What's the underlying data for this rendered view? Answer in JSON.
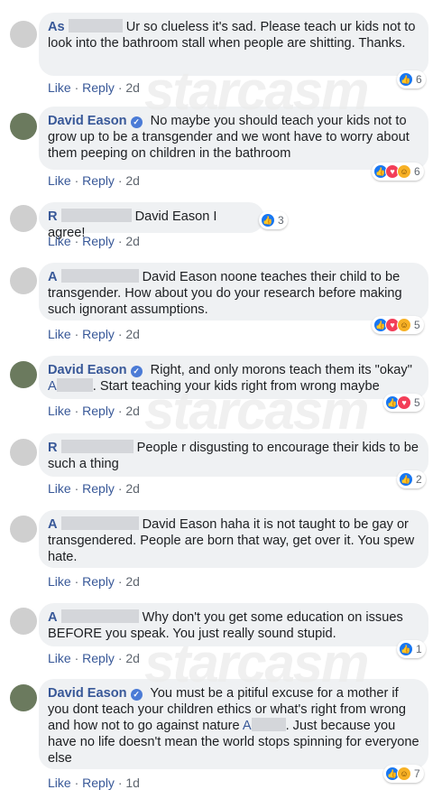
{
  "actions": {
    "like": "Like",
    "reply": "Reply",
    "sep": "·"
  },
  "watermark": "starcasm",
  "comments": [
    {
      "name": "As",
      "text": "Ur so clueless it's sad. Please teach ur kids not to look into the bathroom stall when people are shitting. Thanks.",
      "time": "2d",
      "reactions": "6"
    },
    {
      "name": "David Eason",
      "text": "No maybe you should teach your kids not to grow up to be a transgender and we wont have to worry about them peeping on children in the bathroom",
      "time": "2d",
      "reactions": "6"
    },
    {
      "name": "R",
      "text": "David Eason I agree!",
      "time": "2d",
      "reactions": "3"
    },
    {
      "name": "A",
      "text": "David Eason noone teaches their child to be transgender. How about you do your research before making such ignorant assumptions.",
      "time": "2d",
      "reactions": "5"
    },
    {
      "name": "David Eason",
      "text": "Right, and only morons teach them its \"okay\"",
      "mention": "A",
      "text2": ". Start teaching your kids right from wrong maybe",
      "time": "2d",
      "reactions": "5"
    },
    {
      "name": "R",
      "text": "People r disgusting to encourage their kids to be such a thing",
      "time": "2d",
      "reactions": "2"
    },
    {
      "name": "A",
      "text": "David Eason haha it is not taught to be gay or transgendered. People are born that way, get over it. You spew hate.",
      "time": "2d",
      "reactions": ""
    },
    {
      "name": "A",
      "text": "Why don't you get some education on issues BEFORE you speak. You just really sound stupid.",
      "time": "2d",
      "reactions": "1"
    },
    {
      "name": "David Eason",
      "text": "You must be a pitiful excuse for a mother if you dont teach your children ethics or what's right from wrong and how not to go against nature",
      "mention": "A",
      "text2": ". Just because you have no life doesn't mean the world stops spinning for everyone else",
      "time": "1d",
      "reactions": "7"
    }
  ]
}
